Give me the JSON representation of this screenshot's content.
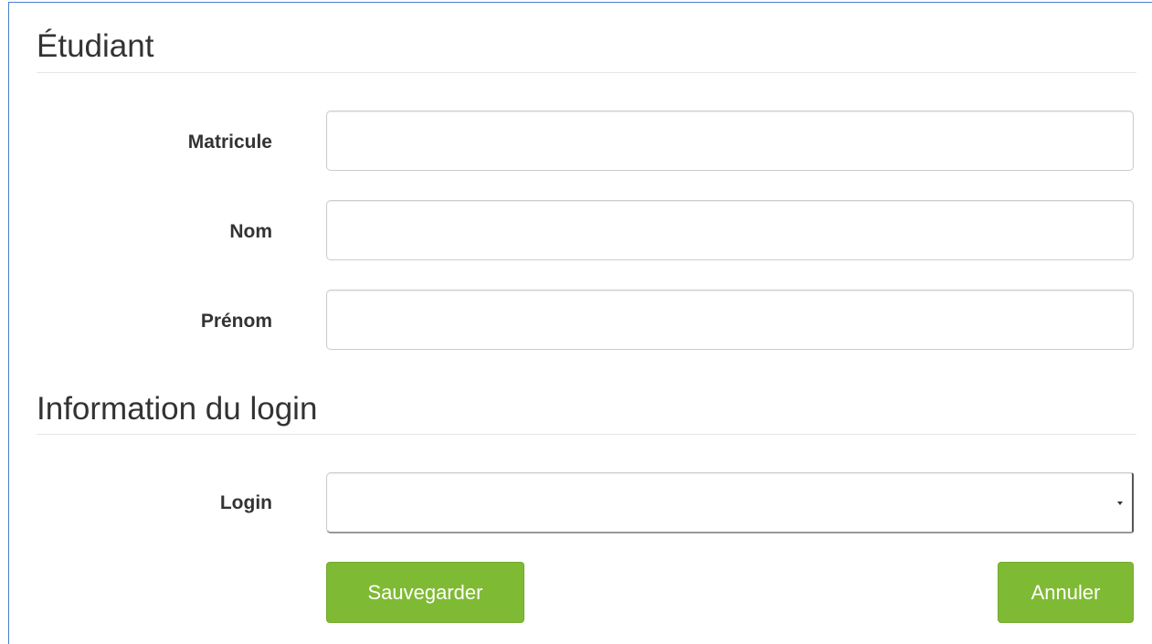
{
  "student_section": {
    "title": "Étudiant",
    "fields": [
      {
        "label": "Matricule",
        "value": "",
        "placeholder": ""
      },
      {
        "label": "Nom",
        "value": "",
        "placeholder": ""
      },
      {
        "label": "Prénom",
        "value": "",
        "placeholder": ""
      }
    ]
  },
  "login_section": {
    "title": "Information du login",
    "login_label": "Login",
    "login_selected": ""
  },
  "actions": {
    "save_label": "Sauvegarder",
    "cancel_label": "Annuler"
  },
  "colors": {
    "button_green": "#7fba34",
    "frame_border": "#4a7fcf"
  }
}
